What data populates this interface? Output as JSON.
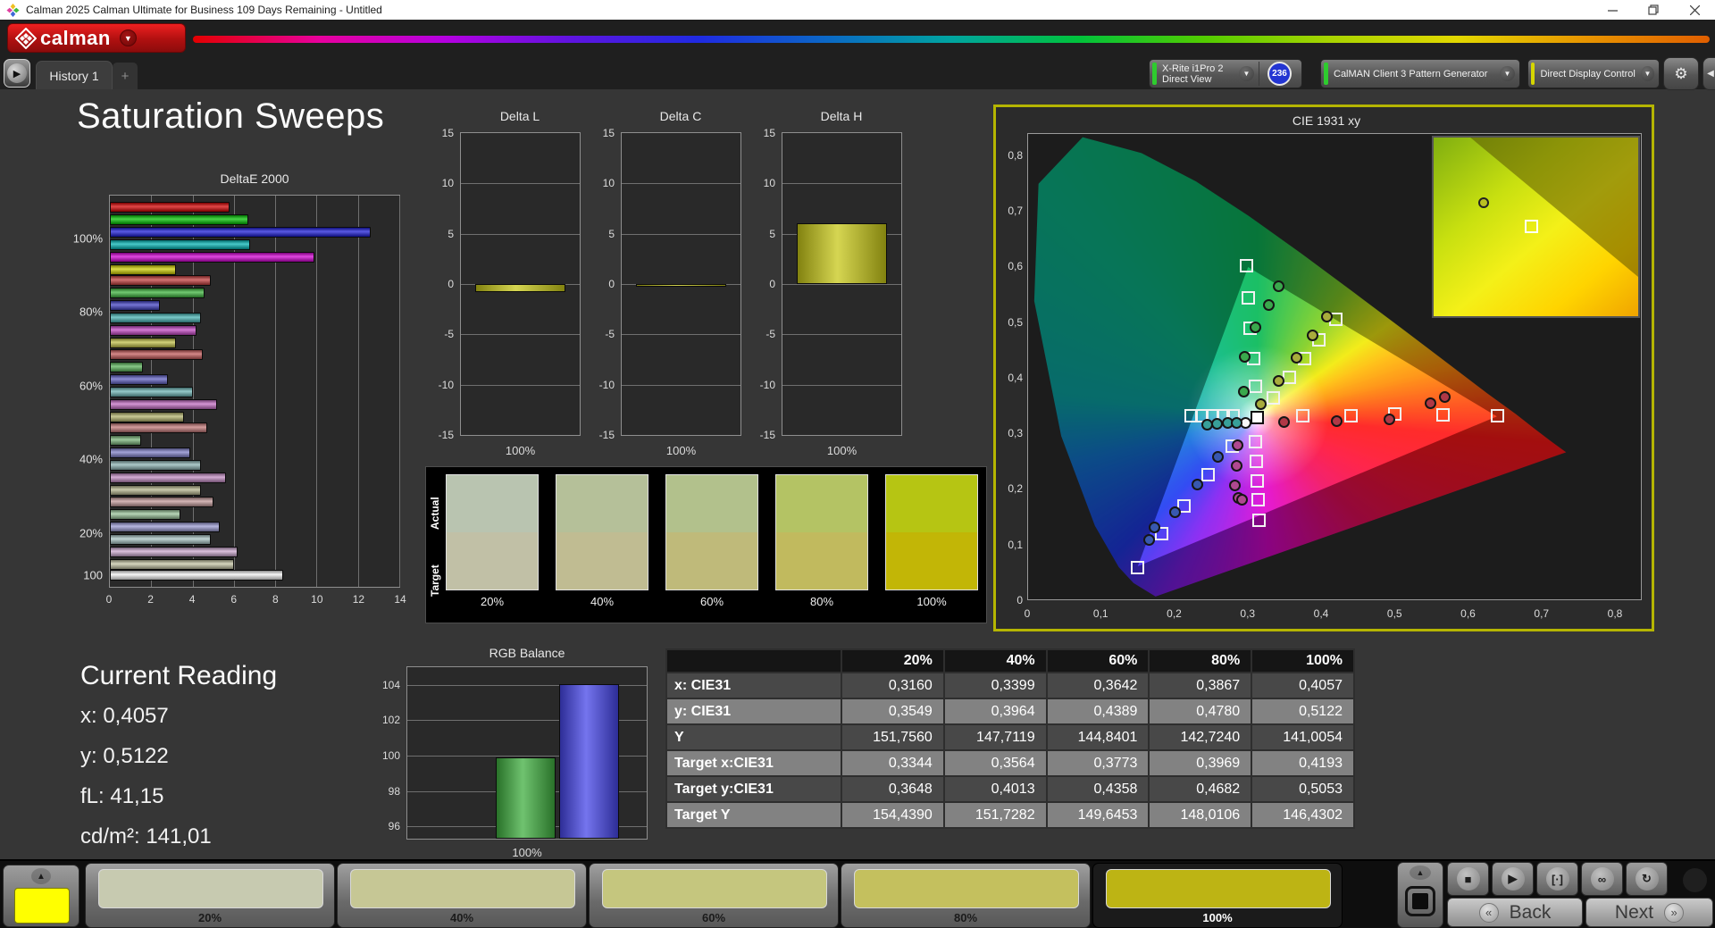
{
  "window": {
    "title": "Calman 2025 Calman Ultimate for Business 109 Days Remaining  - Untitled"
  },
  "header": {
    "logo_text": "calman"
  },
  "toolbar": {
    "history_tab": "History 1",
    "add_tab": "+",
    "meter": {
      "line1": "X-Rite i1Pro 2",
      "line2": "Direct View",
      "badge": "236",
      "accent": "#2ecc2e"
    },
    "pattern_generator": {
      "label": "CalMAN Client 3 Pattern Generator",
      "accent": "#2ecc2e"
    },
    "display_control": {
      "label": "Direct Display Control",
      "accent": "#d6d600"
    }
  },
  "page": {
    "title": "Saturation Sweeps"
  },
  "current_reading": {
    "title": "Current Reading",
    "lines": [
      "x: 0,4057",
      "y: 0,5122",
      "fL: 41,15",
      "cd/m²: 141,01"
    ]
  },
  "chart_data": [
    {
      "type": "bar",
      "title": "DeltaE 2000",
      "orientation": "horizontal",
      "xlabel": "",
      "ylabel": "",
      "xlim": [
        0,
        14
      ],
      "xticks": [
        "0",
        "2",
        "4",
        "6",
        "8",
        "10",
        "12",
        "14"
      ],
      "grid": true,
      "series_names": [
        "Red",
        "Green",
        "Blue",
        "Cyan",
        "Magenta",
        "Yellow"
      ],
      "groups": [
        {
          "label": "100%",
          "values": [
            5.8,
            6.7,
            12.6,
            6.8,
            9.9,
            3.2
          ],
          "colors": [
            "#d40000",
            "#00c400",
            "#1a1ad8",
            "#00b4b4",
            "#d400d4",
            "#d0d000"
          ]
        },
        {
          "label": "80%",
          "values": [
            4.9,
            4.6,
            2.4,
            4.4,
            4.2,
            3.2
          ],
          "colors": [
            "#c43c3c",
            "#3cb43c",
            "#4040c4",
            "#46b4b4",
            "#c446c4",
            "#c0c046"
          ]
        },
        {
          "label": "60%",
          "values": [
            4.5,
            1.6,
            2.8,
            4.0,
            5.2,
            3.6
          ],
          "colors": [
            "#c45a5a",
            "#5ab45a",
            "#6060c4",
            "#6cb4b4",
            "#c46cc4",
            "#b4b46c"
          ]
        },
        {
          "label": "40%",
          "values": [
            4.7,
            1.5,
            3.9,
            4.4,
            5.6,
            4.4
          ],
          "colors": [
            "#c47878",
            "#78b478",
            "#8080c8",
            "#8cb4b4",
            "#c48cc4",
            "#b4b48c"
          ]
        },
        {
          "label": "20%",
          "values": [
            5.0,
            3.4,
            5.3,
            4.9,
            6.2,
            6.0
          ],
          "colors": [
            "#c49a9a",
            "#9ac49a",
            "#9a9ad2",
            "#a8c4c4",
            "#cca8d0",
            "#c4c4a4"
          ]
        },
        {
          "label": "100",
          "values": [
            8.4
          ],
          "colors": [
            "#f2f2f2"
          ]
        }
      ]
    },
    {
      "type": "bar",
      "title": "Delta L",
      "categories": [
        "100%"
      ],
      "values": [
        -0.8
      ],
      "ylim": [
        -15,
        15
      ],
      "yticks": [
        "15",
        "10",
        "5",
        "0",
        "-5",
        "-10",
        "-15"
      ],
      "grid": true,
      "bar_color": "#c8c818"
    },
    {
      "type": "bar",
      "title": "Delta C",
      "categories": [
        "100%"
      ],
      "values": [
        -0.3
      ],
      "ylim": [
        -15,
        15
      ],
      "yticks": [
        "15",
        "10",
        "5",
        "0",
        "-5",
        "-10",
        "-15"
      ],
      "grid": true,
      "bar_color": "#c8c818"
    },
    {
      "type": "bar",
      "title": "Delta H",
      "categories": [
        "100%"
      ],
      "values": [
        6.0
      ],
      "ylim": [
        -15,
        15
      ],
      "yticks": [
        "15",
        "10",
        "5",
        "0",
        "-5",
        "-10",
        "-15"
      ],
      "grid": true,
      "bar_color": "#c8c818"
    },
    {
      "type": "bar",
      "title": "RGB Balance",
      "categories": [
        "100%"
      ],
      "series": [
        {
          "name": "Green",
          "value": 99.9,
          "color": "#3fae3f"
        },
        {
          "name": "Blue",
          "value": 104.05,
          "color": "#4646e8"
        }
      ],
      "ylim": [
        95.3,
        105.0
      ],
      "yticks": [
        "104",
        "102",
        "100",
        "98",
        "96"
      ],
      "grid": true,
      "note_visible_bars": "only green and blue bars visible"
    },
    {
      "type": "scatter",
      "title": "CIE 1931 xy",
      "xlim": [
        0,
        0.8
      ],
      "ylim": [
        0,
        0.84
      ],
      "xticks": [
        "0",
        "0,1",
        "0,2",
        "0,3",
        "0,4",
        "0,5",
        "0,6",
        "0,7",
        "0,8"
      ],
      "yticks": [
        "0",
        "0,1",
        "0,2",
        "0,3",
        "0,4",
        "0,5",
        "0,6",
        "0,7",
        "0,8"
      ],
      "targets": {
        "white": [
          [
            0.3127,
            0.329
          ]
        ],
        "red": [
          [
            0.375,
            0.332
          ],
          [
            0.44,
            0.333
          ],
          [
            0.5,
            0.335
          ],
          [
            0.565,
            0.334
          ],
          [
            0.64,
            0.333
          ]
        ],
        "green": [
          [
            0.31,
            0.385
          ],
          [
            0.307,
            0.435
          ],
          [
            0.303,
            0.49
          ],
          [
            0.3,
            0.545
          ],
          [
            0.298,
            0.602
          ]
        ],
        "blue": [
          [
            0.278,
            0.278
          ],
          [
            0.246,
            0.227
          ],
          [
            0.213,
            0.171
          ],
          [
            0.182,
            0.12
          ],
          [
            0.149,
            0.06
          ]
        ],
        "cyan": [
          [
            0.28,
            0.332
          ],
          [
            0.266,
            0.332
          ],
          [
            0.252,
            0.332
          ],
          [
            0.237,
            0.332
          ],
          [
            0.223,
            0.332
          ]
        ],
        "magenta": [
          [
            0.31,
            0.286
          ],
          [
            0.311,
            0.25
          ],
          [
            0.313,
            0.216
          ],
          [
            0.314,
            0.182
          ],
          [
            0.315,
            0.145
          ]
        ],
        "yellow": [
          [
            0.3344,
            0.3648
          ],
          [
            0.3564,
            0.4013
          ],
          [
            0.3773,
            0.4358
          ],
          [
            0.3969,
            0.4682
          ],
          [
            0.4193,
            0.5053
          ]
        ]
      },
      "measurements": {
        "white": [
          [
            0.296,
            0.322
          ]
        ],
        "red": [
          [
            0.348,
            0.323
          ],
          [
            0.419,
            0.325
          ],
          [
            0.491,
            0.327
          ],
          [
            0.547,
            0.356
          ],
          [
            0.566,
            0.368
          ]
        ],
        "green": [
          [
            0.293,
            0.378
          ],
          [
            0.294,
            0.44
          ],
          [
            0.309,
            0.493
          ],
          [
            0.327,
            0.533
          ],
          [
            0.341,
            0.567
          ]
        ],
        "blue": [
          [
            0.258,
            0.26
          ],
          [
            0.23,
            0.211
          ],
          [
            0.199,
            0.16
          ],
          [
            0.172,
            0.134
          ],
          [
            0.164,
            0.111
          ]
        ],
        "cyan": [
          [
            0.243,
            0.318
          ],
          [
            0.257,
            0.32
          ],
          [
            0.271,
            0.321
          ],
          [
            0.283,
            0.321
          ]
        ],
        "magenta": [
          [
            0.284,
            0.281
          ],
          [
            0.283,
            0.244
          ],
          [
            0.281,
            0.209
          ],
          [
            0.286,
            0.186
          ],
          [
            0.29,
            0.183
          ]
        ],
        "yellow": [
          [
            0.316,
            0.3549
          ],
          [
            0.3399,
            0.3964
          ],
          [
            0.3642,
            0.4389
          ],
          [
            0.3867,
            0.478
          ],
          [
            0.4057,
            0.5122
          ]
        ]
      },
      "measurement_colors": {
        "white": "#f8f8f8",
        "red": "#b03846",
        "green": "#3aa84c",
        "blue": "#3858b0",
        "cyan": "#38a09a",
        "magenta": "#b04890",
        "yellow": "#a8ac3c"
      },
      "inset_markers": {
        "circle": [
          0.24,
          0.36
        ],
        "square": [
          0.47,
          0.49
        ]
      }
    }
  ],
  "swatch_panel": {
    "row_labels": [
      "Actual",
      "Target"
    ],
    "columns": [
      {
        "label": "20%",
        "actual": "#b9c4b0",
        "target": "#c1c0a6"
      },
      {
        "label": "40%",
        "actual": "#b5c099",
        "target": "#c0bc92"
      },
      {
        "label": "60%",
        "actual": "#b2c18c",
        "target": "#bfba7a"
      },
      {
        "label": "80%",
        "actual": "#b4c364",
        "target": "#c1ba5e"
      },
      {
        "label": "100%",
        "actual": "#b6c513",
        "target": "#c2b606"
      }
    ]
  },
  "table": {
    "headers": [
      "",
      "20%",
      "40%",
      "60%",
      "80%",
      "100%"
    ],
    "rows": [
      {
        "label": "x: CIE31",
        "values": [
          "0,3160",
          "0,3399",
          "0,3642",
          "0,3867",
          "0,4057"
        ]
      },
      {
        "label": "y: CIE31",
        "values": [
          "0,3549",
          "0,3964",
          "0,4389",
          "0,4780",
          "0,5122"
        ]
      },
      {
        "label": "Y",
        "values": [
          "151,7560",
          "147,7119",
          "144,8401",
          "142,7240",
          "141,0054"
        ]
      },
      {
        "label": "Target x:CIE31",
        "values": [
          "0,3344",
          "0,3564",
          "0,3773",
          "0,3969",
          "0,4193"
        ]
      },
      {
        "label": "Target y:CIE31",
        "values": [
          "0,3648",
          "0,4013",
          "0,4358",
          "0,4682",
          "0,5053"
        ]
      },
      {
        "label": "Target Y",
        "values": [
          "154,4390",
          "151,7282",
          "149,6453",
          "148,0106",
          "146,4302"
        ]
      }
    ]
  },
  "bottom_bar": {
    "pattern_color": "#ffff00",
    "swatches": [
      {
        "label": "20%",
        "color": "#c7cab0",
        "selected": false
      },
      {
        "label": "40%",
        "color": "#c6c795",
        "selected": false
      },
      {
        "label": "60%",
        "color": "#c5c67e",
        "selected": false
      },
      {
        "label": "80%",
        "color": "#c4c05e",
        "selected": false
      },
      {
        "label": "100%",
        "color": "#bdb414",
        "selected": true
      }
    ],
    "transport": [
      {
        "name": "stop-button",
        "glyph": "■"
      },
      {
        "name": "play-button",
        "glyph": "▶"
      },
      {
        "name": "step-button",
        "glyph": "[·]"
      },
      {
        "name": "loop-button",
        "glyph": "∞"
      },
      {
        "name": "refresh-button",
        "glyph": "↻"
      }
    ],
    "back_label": "Back",
    "next_label": "Next",
    "back_glyph": "«",
    "next_glyph": "»"
  }
}
